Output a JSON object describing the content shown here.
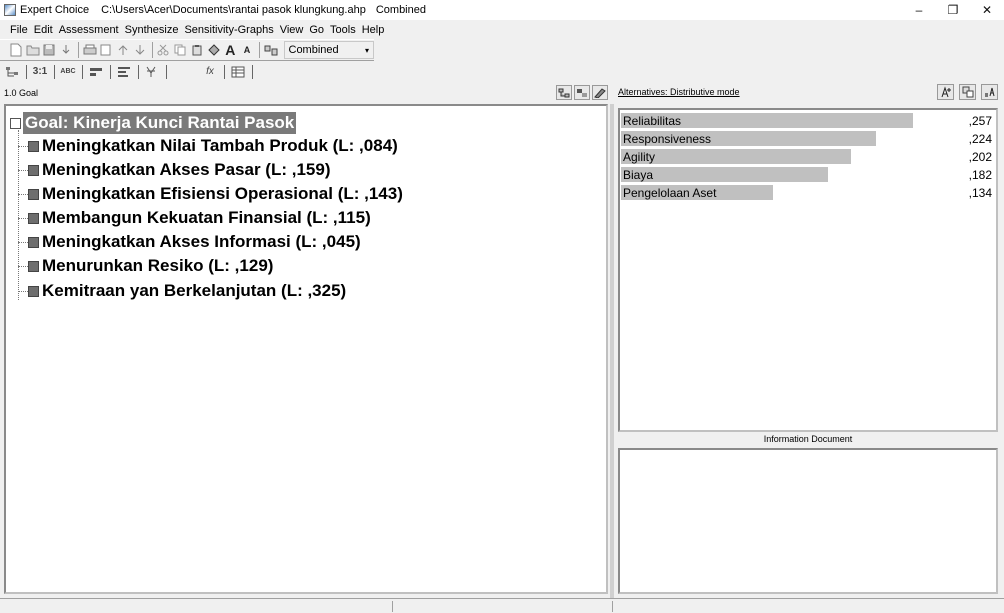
{
  "window": {
    "app_name": "Expert Choice",
    "file_path": "C:\\Users\\Acer\\Documents\\rantai pasok klungkung.ahp",
    "mode": "Combined",
    "minimize": "–",
    "maximize": "❐",
    "close": "✕"
  },
  "menu": [
    "File",
    "Edit",
    "Assessment",
    "Synthesize",
    "Sensitivity-Graphs",
    "View",
    "Go",
    "Tools",
    "Help"
  ],
  "toolbar": {
    "combo_value": "Combined",
    "combo_arrow": "▾",
    "text_btn_large": "A",
    "text_btn_small": "A",
    "tb2_1": "3:1",
    "tb2_2": "ABC",
    "tb2_fx": "fx"
  },
  "left_pane": {
    "header_label": "1.0 Goal",
    "goal": "Goal: Kinerja Kunci Rantai Pasok",
    "objectives": [
      "Meningkatkan Nilai Tambah Produk (L: ,084)",
      "Meningkatkan Akses Pasar (L: ,159)",
      "Meningkatkan Efisiensi Operasional (L: ,143)",
      "Membangun Kekuatan Finansial (L: ,115)",
      "Meningkatkan Akses Informasi (L: ,045)",
      "Menurunkan Resiko (L: ,129)",
      "Kemitraan yan Berkelanjutan (L: ,325)"
    ]
  },
  "right_pane": {
    "header_label": "Alternatives: Distributive mode",
    "alternatives": [
      {
        "name": "Reliabilitas",
        "value_label": ",257",
        "value": 0.257
      },
      {
        "name": "Responsiveness",
        "value_label": ",224",
        "value": 0.224
      },
      {
        "name": "Agility",
        "value_label": ",202",
        "value": 0.202
      },
      {
        "name": "Biaya",
        "value_label": ",182",
        "value": 0.182
      },
      {
        "name": "Pengelolaan Aset",
        "value_label": ",134",
        "value": 0.134
      }
    ],
    "info_label": "Information Document"
  }
}
